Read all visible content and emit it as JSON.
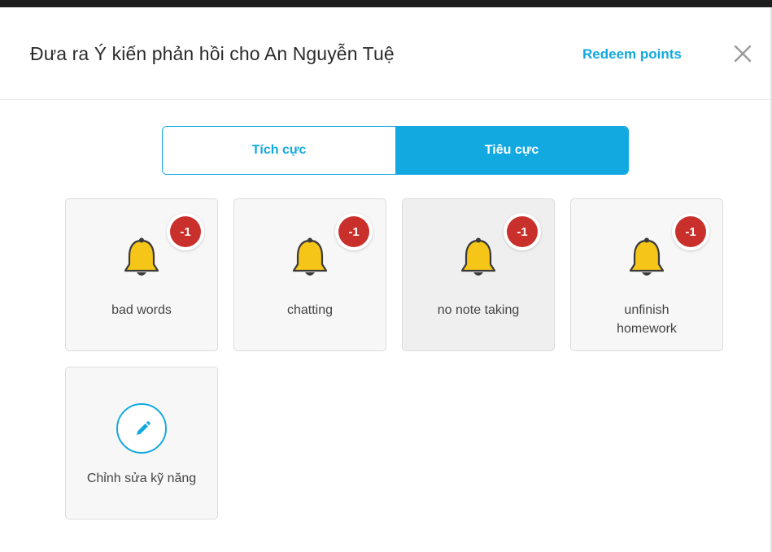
{
  "dialog": {
    "title": "Đưa ra Ý kiến phản hồi cho An Nguyễn Tuệ",
    "redeem_label": "Redeem points",
    "close_icon": "close-icon"
  },
  "tabs": [
    {
      "label": "Tích cực",
      "active": false
    },
    {
      "label": "Tiêu cực",
      "active": true
    }
  ],
  "skills": [
    {
      "label": "bad words",
      "points": "-1",
      "icon": "bell-icon"
    },
    {
      "label": "chatting",
      "points": "-1",
      "icon": "bell-icon"
    },
    {
      "label": "no note taking",
      "points": "-1",
      "icon": "bell-icon"
    },
    {
      "label": "unfinish homework",
      "points": "-1",
      "icon": "bell-icon"
    }
  ],
  "edit_skills": {
    "label": "Chỉnh sửa kỹ năng",
    "icon": "pencil-icon"
  },
  "colors": {
    "accent": "#12a9e0",
    "badge": "#c9302c",
    "bell": "#f5c518"
  }
}
